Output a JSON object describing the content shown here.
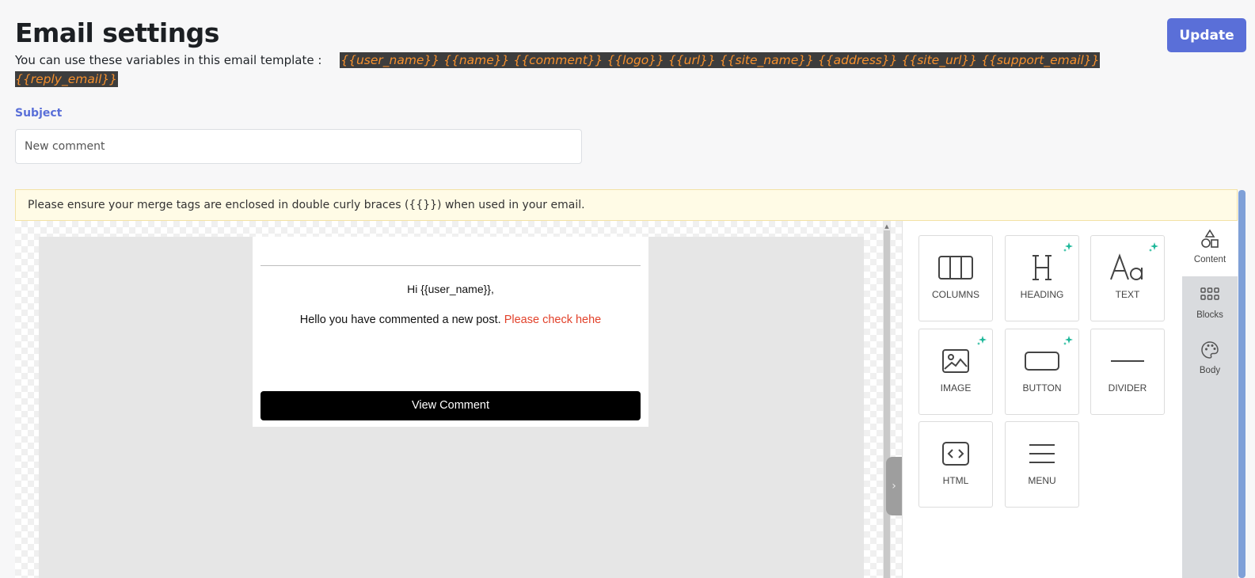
{
  "header": {
    "title": "Email settings",
    "update_label": "Update"
  },
  "variables": {
    "hint": "You can use these variables in this email template :",
    "tags": "{{user_name}} {{name}} {{comment}} {{logo}} {{url}} {{site_name}} {{address}} {{site_url}} {{support_email}} {{reply_email}}"
  },
  "subject": {
    "label": "Subject",
    "value": "New comment"
  },
  "notice": "Please ensure your merge tags are enclosed in double curly braces ({{}}) when used in your email.",
  "email_preview": {
    "greeting": "Hi {{user_name}},",
    "message": "Hello you have commented a new post.",
    "link_text": "Please check hehe",
    "cta_label": "View Comment"
  },
  "content_tools": [
    {
      "label": "COLUMNS",
      "icon": "columns-icon",
      "sparkle": false
    },
    {
      "label": "HEADING",
      "icon": "heading-icon",
      "sparkle": true
    },
    {
      "label": "TEXT",
      "icon": "text-icon",
      "sparkle": true
    },
    {
      "label": "IMAGE",
      "icon": "image-icon",
      "sparkle": true
    },
    {
      "label": "BUTTON",
      "icon": "button-icon",
      "sparkle": true
    },
    {
      "label": "DIVIDER",
      "icon": "divider-icon",
      "sparkle": false
    },
    {
      "label": "HTML",
      "icon": "html-icon",
      "sparkle": false
    },
    {
      "label": "MENU",
      "icon": "menu-icon",
      "sparkle": false
    }
  ],
  "side_tabs": [
    {
      "label": "Content",
      "icon": "shapes-icon",
      "active": true
    },
    {
      "label": "Blocks",
      "icon": "blocks-grid-icon",
      "active": false
    },
    {
      "label": "Body",
      "icon": "palette-icon",
      "active": false
    }
  ],
  "colors": {
    "accent": "#5a6fd8",
    "tag_text": "#f5902e",
    "tag_bg": "#3d3d3d",
    "link_red": "#e2412a",
    "sparkle_teal": "#1fb89a",
    "notice_bg": "#fffbe6"
  }
}
